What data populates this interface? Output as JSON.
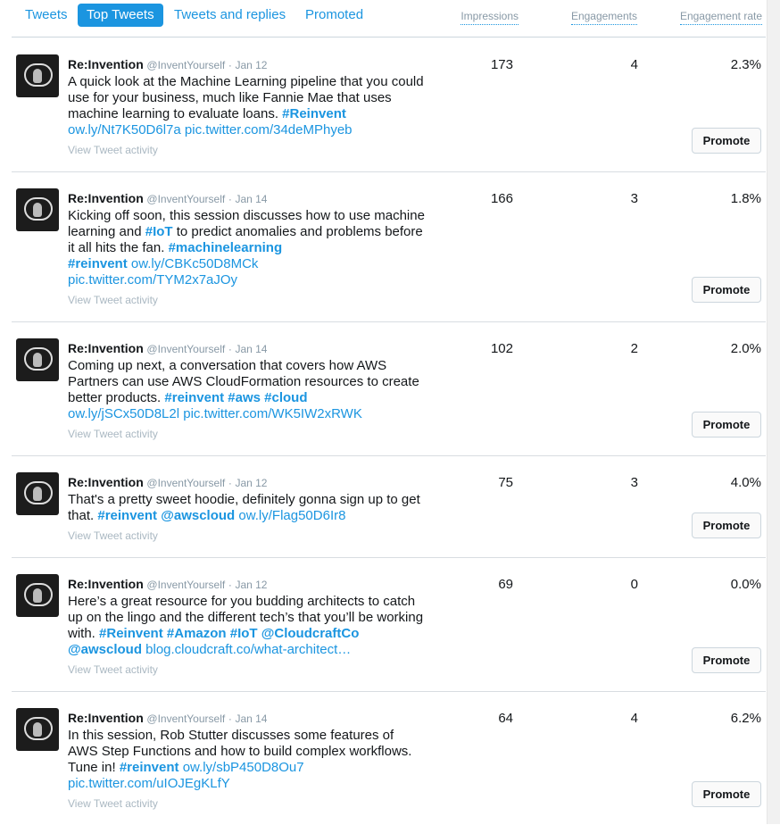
{
  "tabs": [
    "Tweets",
    "Top Tweets",
    "Tweets and replies",
    "Promoted"
  ],
  "columns": {
    "impressions": "Impressions",
    "engagements": "Engagements",
    "rate": "Engagement rate"
  },
  "common": {
    "name": "Re:Invention",
    "handle": "@InventYourself",
    "dot": "·",
    "activity": "View Tweet activity",
    "promote": "Promote"
  },
  "tweets": [
    {
      "date": "Jan 12",
      "impressions": "173",
      "engagements": "4",
      "rate": "2.3%",
      "parts": [
        {
          "t": "text",
          "v": "A quick look at the Machine Learning pipeline that you could use for your business, much like Fannie Mae that uses machine learning to evaluate loans. "
        },
        {
          "t": "tag",
          "v": "#Reinvent"
        },
        {
          "t": "br",
          "v": ""
        },
        {
          "t": "link",
          "v": "ow.ly/Nt7K50D6l7a"
        },
        {
          "t": "text",
          "v": " "
        },
        {
          "t": "link",
          "v": "pic.twitter.com/34deMPhyeb"
        }
      ]
    },
    {
      "date": "Jan 14",
      "impressions": "166",
      "engagements": "3",
      "rate": "1.8%",
      "parts": [
        {
          "t": "text",
          "v": "Kicking off soon, this session discusses how to use machine learning and "
        },
        {
          "t": "tag",
          "v": "#IoT"
        },
        {
          "t": "text",
          "v": " to predict anomalies and problems before it all hits the fan. "
        },
        {
          "t": "tag",
          "v": "#machinelearning"
        },
        {
          "t": "br",
          "v": ""
        },
        {
          "t": "tag",
          "v": "#reinvent"
        },
        {
          "t": "text",
          "v": " "
        },
        {
          "t": "link",
          "v": "ow.ly/CBKc50D8MCk"
        },
        {
          "t": "br",
          "v": ""
        },
        {
          "t": "link",
          "v": "pic.twitter.com/TYM2x7aJOy"
        }
      ]
    },
    {
      "date": "Jan 14",
      "impressions": "102",
      "engagements": "2",
      "rate": "2.0%",
      "parts": [
        {
          "t": "text",
          "v": "Coming up next, a conversation that covers how AWS Partners can use AWS CloudFormation resources to create better products. "
        },
        {
          "t": "tag",
          "v": "#reinvent"
        },
        {
          "t": "text",
          "v": " "
        },
        {
          "t": "tag",
          "v": "#aws"
        },
        {
          "t": "text",
          "v": " "
        },
        {
          "t": "tag",
          "v": "#cloud"
        },
        {
          "t": "br",
          "v": ""
        },
        {
          "t": "link",
          "v": "ow.ly/jSCx50D8L2l"
        },
        {
          "t": "text",
          "v": " "
        },
        {
          "t": "link",
          "v": "pic.twitter.com/WK5IW2xRWK"
        }
      ]
    },
    {
      "date": "Jan 12",
      "impressions": "75",
      "engagements": "3",
      "rate": "4.0%",
      "parts": [
        {
          "t": "text",
          "v": "That's a pretty sweet hoodie, definitely gonna sign up to get that. "
        },
        {
          "t": "tag",
          "v": "#reinvent"
        },
        {
          "t": "text",
          "v": " "
        },
        {
          "t": "tag",
          "v": "@awscloud"
        },
        {
          "t": "text",
          "v": " "
        },
        {
          "t": "link",
          "v": "ow.ly/Flag50D6Ir8"
        }
      ]
    },
    {
      "date": "Jan 12",
      "impressions": "69",
      "engagements": "0",
      "rate": "0.0%",
      "parts": [
        {
          "t": "text",
          "v": "Here’s a great resource for you budding architects to catch up on the lingo and the different tech’s that you’ll be working with. "
        },
        {
          "t": "tag",
          "v": "#Reinvent"
        },
        {
          "t": "text",
          "v": " "
        },
        {
          "t": "tag",
          "v": "#Amazon"
        },
        {
          "t": "text",
          "v": " "
        },
        {
          "t": "tag",
          "v": "#IoT"
        },
        {
          "t": "text",
          "v": " "
        },
        {
          "t": "tag",
          "v": "@CloudcraftCo"
        },
        {
          "t": "br",
          "v": ""
        },
        {
          "t": "tag",
          "v": "@awscloud"
        },
        {
          "t": "text",
          "v": " "
        },
        {
          "t": "link",
          "v": "blog.cloudcraft.co/what-architect…"
        }
      ]
    },
    {
      "date": "Jan 14",
      "impressions": "64",
      "engagements": "4",
      "rate": "6.2%",
      "parts": [
        {
          "t": "text",
          "v": "In this session, Rob Stutter discusses some features of AWS Step Functions and how to build complex workflows. Tune in! "
        },
        {
          "t": "tag",
          "v": "#reinvent"
        },
        {
          "t": "text",
          "v": " "
        },
        {
          "t": "link",
          "v": "ow.ly/sbP450D8Ou7"
        },
        {
          "t": "br",
          "v": ""
        },
        {
          "t": "link",
          "v": "pic.twitter.com/uIOJEgKLfY"
        }
      ]
    }
  ]
}
